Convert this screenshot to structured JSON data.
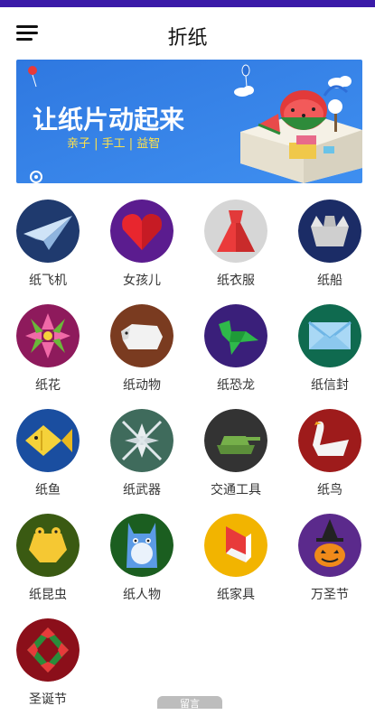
{
  "header": {
    "title": "折纸",
    "menu_icon": "hamburger-menu-icon"
  },
  "banner": {
    "headline": "让纸片动起来",
    "tags": "亲子 | 手工 | 益智",
    "bg_color": "#2d6fd8"
  },
  "categories": [
    {
      "label": "纸飞机",
      "icon": "paper-airplane-icon",
      "color": "#1f3a6e"
    },
    {
      "label": "女孩儿",
      "icon": "heart-icon",
      "color": "#5b1c8f"
    },
    {
      "label": "纸衣服",
      "icon": "dress-icon",
      "color": "#bdbdbd"
    },
    {
      "label": "纸船",
      "icon": "boat-icon",
      "color": "#1b2c66"
    },
    {
      "label": "纸花",
      "icon": "flower-icon",
      "color": "#8e1a5c"
    },
    {
      "label": "纸动物",
      "icon": "animal-icon",
      "color": "#7a3b20"
    },
    {
      "label": "纸恐龙",
      "icon": "dinosaur-icon",
      "color": "#3a1f7a"
    },
    {
      "label": "纸信封",
      "icon": "envelope-icon",
      "color": "#0f6a4f"
    },
    {
      "label": "纸鱼",
      "icon": "fish-icon",
      "color": "#1a4ea0"
    },
    {
      "label": "纸武器",
      "icon": "weapon-icon",
      "color": "#3f6b5c"
    },
    {
      "label": "交通工具",
      "icon": "tank-icon",
      "color": "#333333"
    },
    {
      "label": "纸鸟",
      "icon": "swan-icon",
      "color": "#9e1b1b"
    },
    {
      "label": "纸昆虫",
      "icon": "frog-icon",
      "color": "#3a5a12"
    },
    {
      "label": "纸人物",
      "icon": "character-icon",
      "color": "#1b5e20"
    },
    {
      "label": "纸家具",
      "icon": "furniture-icon",
      "color": "#f2b400"
    },
    {
      "label": "万圣节",
      "icon": "pumpkin-icon",
      "color": "#5b2a8c"
    },
    {
      "label": "圣诞节",
      "icon": "wreath-icon",
      "color": "#8b0f1a"
    }
  ],
  "bottom_pill": {
    "label": "留言"
  }
}
